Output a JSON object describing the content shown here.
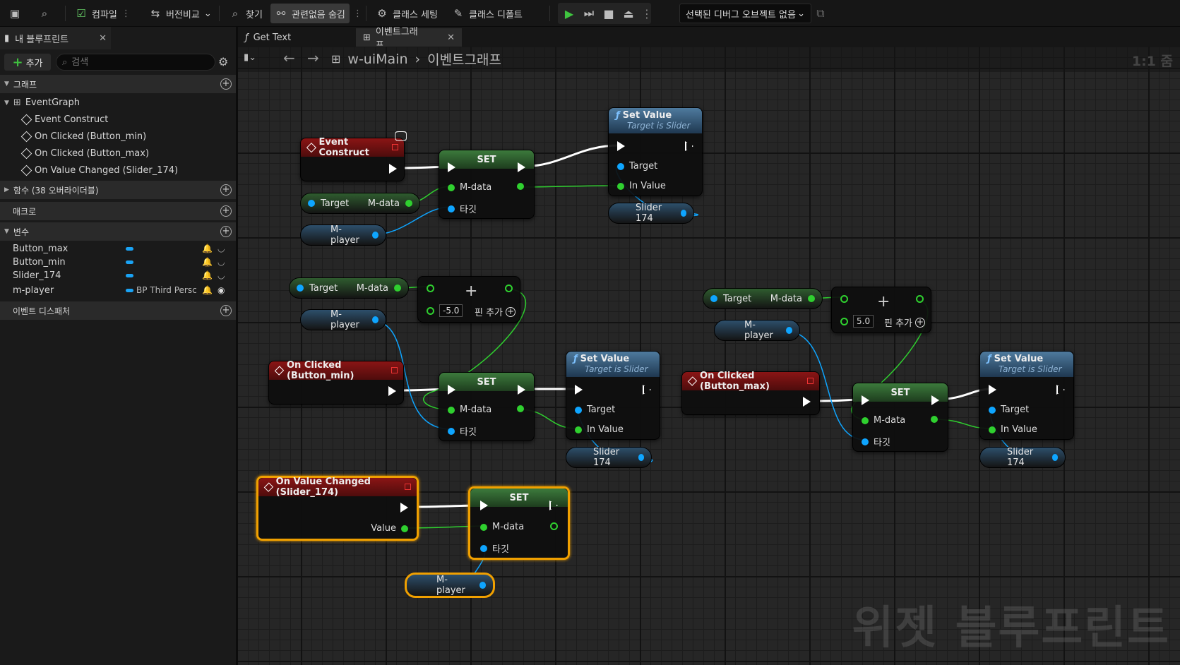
{
  "toolbar": {
    "compile": "컴파일",
    "diff": "버전비교",
    "find": "찾기",
    "hide_unrelated": "관련없음 숨김",
    "class_settings": "클래스 세팅",
    "class_defaults": "클래스 디폴트",
    "debug_object": "선택된 디버그 오브젝트 없음"
  },
  "left_panel": {
    "tab": "내 블루프린트",
    "add_button": "추가",
    "search_placeholder": "검색",
    "sections": {
      "graphs": "그래프",
      "functions": "함수 (38 오버라이더블)",
      "macros": "매크로",
      "variables": "변수",
      "dispatchers": "이벤트 디스패처"
    },
    "event_graph": "EventGraph",
    "events": [
      "Event Construct",
      "On Clicked (Button_min)",
      "On Clicked (Button_max)",
      "On Value Changed (Slider_174)"
    ],
    "variables": [
      {
        "name": "Button_max",
        "type": ""
      },
      {
        "name": "Button_min",
        "type": ""
      },
      {
        "name": "Slider_174",
        "type": ""
      },
      {
        "name": "m-player",
        "type": "BP Third Persc"
      }
    ]
  },
  "graph_tabs": [
    "Get Text",
    "이벤트그래프"
  ],
  "breadcrumb": {
    "root": "w-uiMain",
    "current": "이벤트그래프"
  },
  "zoom": "1:1 줌",
  "watermark": "위젯 블루프린트",
  "nodes": {
    "event_construct": "Event Construct",
    "on_clicked_min": "On Clicked (Button_min)",
    "on_clicked_max": "On Clicked (Button_max)",
    "on_value_changed": "On Value Changed (Slider_174)",
    "set": "SET",
    "set_value": "Set Value",
    "target_is_slider": "Target is Slider",
    "pin_target": "Target",
    "pin_mdata": "M-data",
    "pin_target_kr": "타깃",
    "pin_in_value": "In Value",
    "pin_value": "Value",
    "var_slider": "Slider 174",
    "var_mplayer": "M-player",
    "add_pin": "핀 추가",
    "val_min": "-5.0",
    "val_max": "5.0"
  }
}
